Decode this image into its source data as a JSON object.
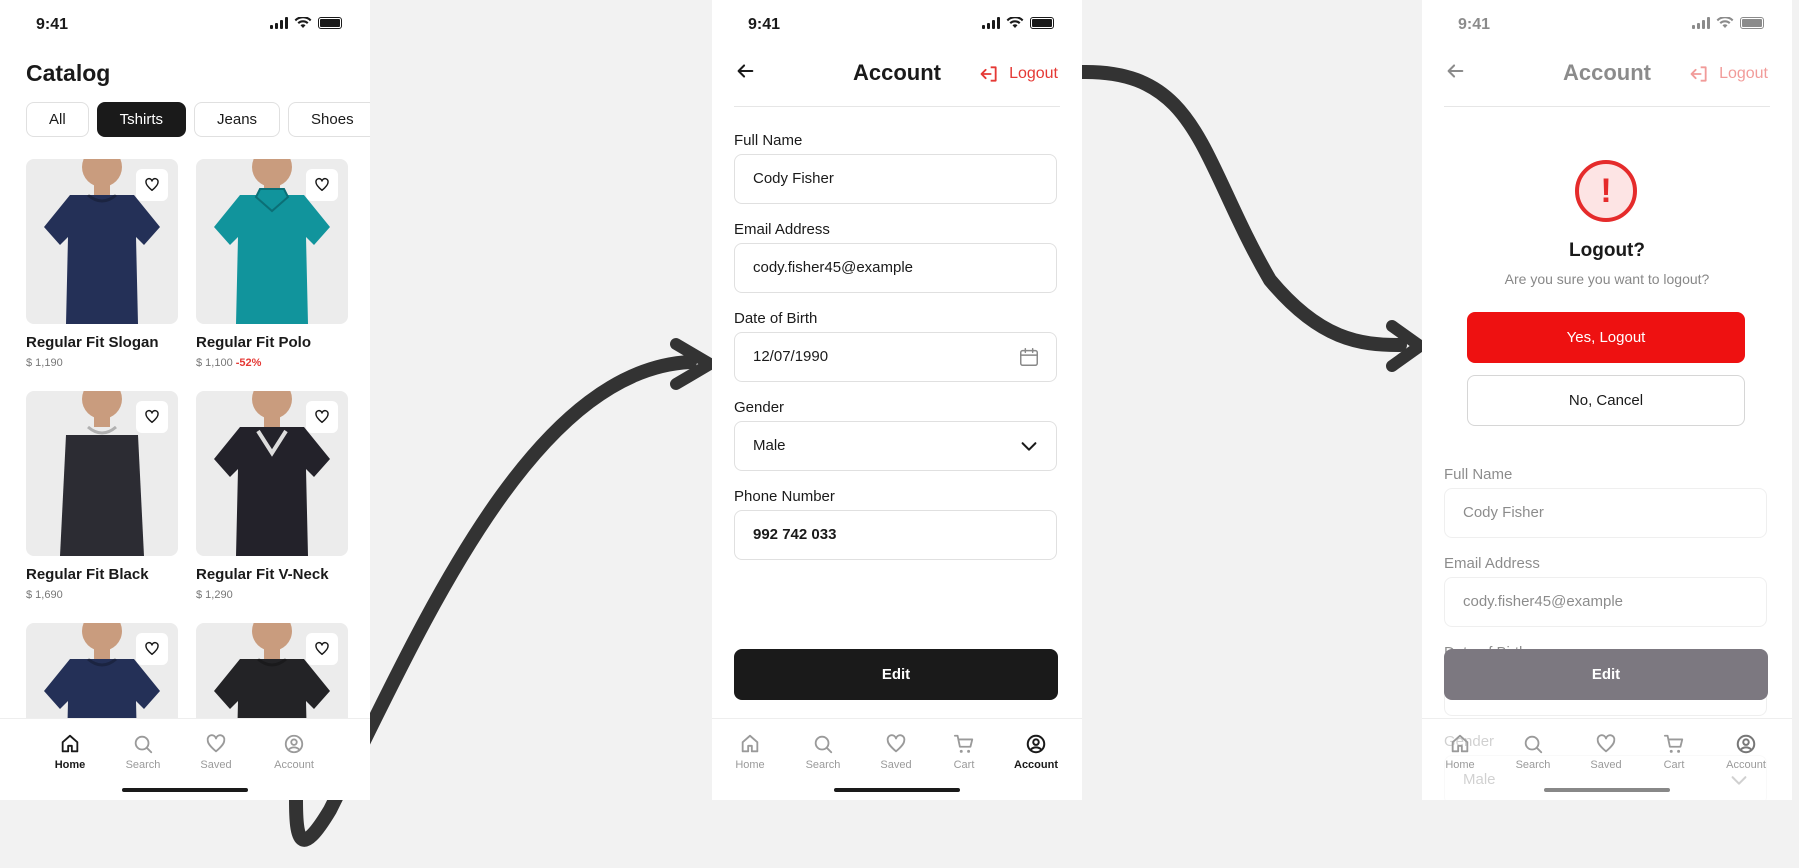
{
  "status": {
    "time": "9:41"
  },
  "catalog": {
    "title": "Catalog",
    "chips": [
      "All",
      "Tshirts",
      "Jeans",
      "Shoes"
    ],
    "active_chip": "Tshirts",
    "products": [
      {
        "name": "Regular Fit Slogan",
        "price": "$ 1,190",
        "discount": "",
        "shirt_color": "#243057",
        "collar": "crew"
      },
      {
        "name": "Regular Fit Polo",
        "price": "$ 1,100",
        "discount": "-52%",
        "shirt_color": "#11949c",
        "collar": "polo"
      },
      {
        "name": "Regular Fit Black",
        "price": "$ 1,690",
        "discount": "",
        "shirt_color": "#2c2c33",
        "collar": "sleeveless"
      },
      {
        "name": "Regular Fit V-Neck",
        "price": "$ 1,290",
        "discount": "",
        "shirt_color": "#23222a",
        "collar": "vneck"
      },
      {
        "name": "",
        "price": "",
        "discount": "",
        "shirt_color": "#243057",
        "collar": "crew"
      },
      {
        "name": "",
        "price": "",
        "discount": "",
        "shirt_color": "#232326",
        "collar": "crew"
      }
    ]
  },
  "tabs": {
    "home": "Home",
    "search": "Search",
    "saved": "Saved",
    "cart": "Cart",
    "account": "Account"
  },
  "account": {
    "title": "Account",
    "logout_label": "Logout",
    "fields": {
      "full_name": {
        "label": "Full Name",
        "value": "Cody Fisher"
      },
      "email": {
        "label": "Email Address",
        "value": "cody.fisher45@example"
      },
      "dob": {
        "label": "Date of Birth",
        "value": "12/07/1990"
      },
      "gender": {
        "label": "Gender",
        "value": "Male"
      },
      "phone": {
        "label": "Phone Number",
        "value": "992 742 033"
      }
    },
    "edit_label": "Edit"
  },
  "logout_dialog": {
    "icon": "!",
    "title": "Logout?",
    "message": "Are you sure you want to logout?",
    "confirm_label": "Yes, Logout",
    "cancel_label": "No, Cancel",
    "partial_dob_label": "Date of Birth"
  },
  "colors": {
    "accent_red": "#e53935",
    "confirm_red": "#ee1111",
    "dark": "#1a1a1a",
    "arrow": "#333333"
  }
}
